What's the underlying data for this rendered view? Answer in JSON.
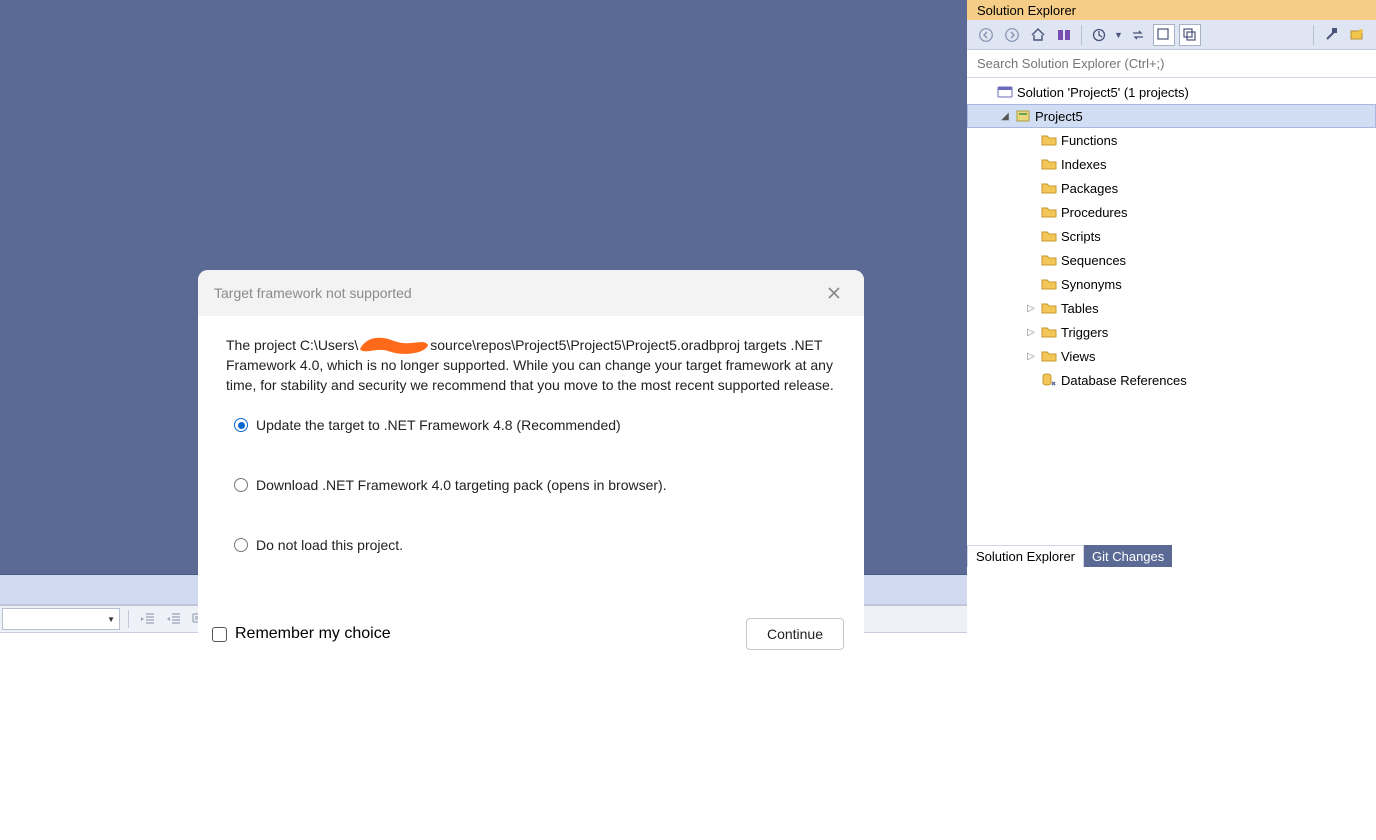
{
  "solution_explorer": {
    "title": "Solution Explorer",
    "search_placeholder": "Search Solution Explorer (Ctrl+;)",
    "solution_label": "Solution 'Project5' (1 projects)",
    "project_name": "Project5",
    "items": [
      {
        "label": "Functions",
        "expandable": false
      },
      {
        "label": "Indexes",
        "expandable": false
      },
      {
        "label": "Packages",
        "expandable": false
      },
      {
        "label": "Procedures",
        "expandable": false
      },
      {
        "label": "Scripts",
        "expandable": false
      },
      {
        "label": "Sequences",
        "expandable": false
      },
      {
        "label": "Synonyms",
        "expandable": false
      },
      {
        "label": "Tables",
        "expandable": true
      },
      {
        "label": "Triggers",
        "expandable": true
      },
      {
        "label": "Views",
        "expandable": true
      },
      {
        "label": "Database References",
        "expandable": false,
        "icon": "dbref"
      }
    ],
    "tabs": {
      "active": "Solution Explorer",
      "inactive": "Git Changes"
    }
  },
  "dialog": {
    "title": "Target framework not supported",
    "msg_before": "The  project C:\\Users\\",
    "msg_after": "source\\repos\\Project5\\Project5\\Project5.oradbproj targets .NET Framework 4.0, which is no longer supported. While you can change your target framework at any time, for stability and security we recommend that you move to the most recent supported release.",
    "option1": "Update the target to .NET Framework 4.8 (Recommended)",
    "option2": "Download .NET Framework 4.0 targeting pack (opens in browser).",
    "option3": "Do not load this project.",
    "remember": "Remember my choice",
    "continue": "Continue"
  }
}
